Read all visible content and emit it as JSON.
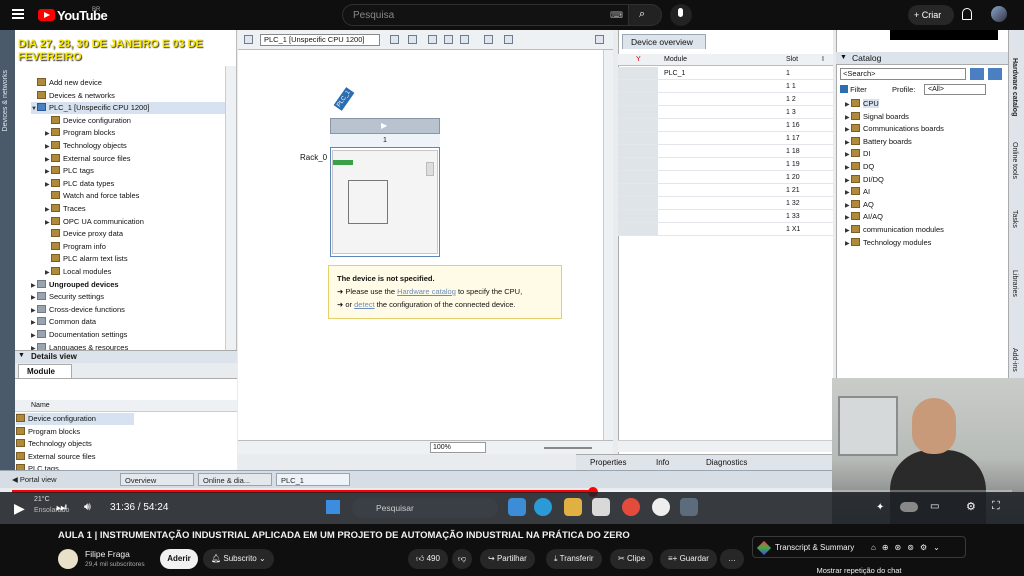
{
  "youtube": {
    "logo": "YouTube",
    "region": "BR",
    "search_placeholder": "Pesquisa",
    "create_label": "Criar"
  },
  "video": {
    "overlay_title": "DIA 27, 28, 30 DE JANEIRO E 03 DE FEVEREIRO",
    "time": "31:36 / 54:24",
    "progress_fraction": 0.581,
    "weather_temp": "21°C",
    "weather_desc": "Ensolarado",
    "taskbar_search": "Pesquisar"
  },
  "tia": {
    "tree": [
      {
        "label": "Add new device",
        "indent": 0
      },
      {
        "label": "Devices & networks",
        "indent": 0
      },
      {
        "label": "PLC_1 [Unspecific CPU 1200]",
        "indent": 0
      },
      {
        "label": "Device configuration",
        "indent": 1
      },
      {
        "label": "Program blocks",
        "indent": 1
      },
      {
        "label": "Technology objects",
        "indent": 1
      },
      {
        "label": "External source files",
        "indent": 1
      },
      {
        "label": "PLC tags",
        "indent": 1
      },
      {
        "label": "PLC data types",
        "indent": 1
      },
      {
        "label": "Watch and force tables",
        "indent": 1
      },
      {
        "label": "Traces",
        "indent": 1
      },
      {
        "label": "OPC UA communication",
        "indent": 1
      },
      {
        "label": "Device proxy data",
        "indent": 1
      },
      {
        "label": "Program info",
        "indent": 1
      },
      {
        "label": "PLC alarm text lists",
        "indent": 1
      },
      {
        "label": "Local modules",
        "indent": 1
      },
      {
        "label": "Ungrouped devices",
        "indent": 0
      },
      {
        "label": "Security settings",
        "indent": 0
      },
      {
        "label": "Cross-device functions",
        "indent": 0
      },
      {
        "label": "Common data",
        "indent": 0
      },
      {
        "label": "Documentation settings",
        "indent": 0
      },
      {
        "label": "Languages & resources",
        "indent": 0
      }
    ],
    "details_view": "Details view",
    "details_tab": "Module",
    "details_col_name": "Name",
    "details_rows": [
      "Device configuration",
      "Program blocks",
      "Technology objects",
      "External source files",
      "PLC tags"
    ],
    "device_select": "PLC_1 [Unspecific CPU 1200]",
    "plc_tag": "PLC_1",
    "rack_label": "Rack_0",
    "slot_number": "1",
    "info_title": "The device is not specified.",
    "info_line1_a": "Please use the",
    "info_line1_link": "Hardware catalog",
    "info_line1_b": "to specify the CPU,",
    "info_line2_a": "or",
    "info_line2_link": "detect",
    "info_line2_b": "the configuration of the connected device.",
    "zoom": "100%",
    "overview_tab": "Device overview",
    "overview_col_module": "Module",
    "overview_col_slot": "Slot",
    "overview_col_i": "I",
    "overview_rows": [
      {
        "module": "PLC_1",
        "slot": "1"
      },
      {
        "module": "",
        "slot": "1 1"
      },
      {
        "module": "",
        "slot": "1 2"
      },
      {
        "module": "",
        "slot": "1 3"
      },
      {
        "module": "",
        "slot": "1 16"
      },
      {
        "module": "",
        "slot": "1 17"
      },
      {
        "module": "",
        "slot": "1 18"
      },
      {
        "module": "",
        "slot": "1 19"
      },
      {
        "module": "",
        "slot": "1 20"
      },
      {
        "module": "",
        "slot": "1 21"
      },
      {
        "module": "",
        "slot": "1 32"
      },
      {
        "module": "",
        "slot": "1 33"
      },
      {
        "module": "",
        "slot": "1 X1"
      }
    ],
    "catalog_title": "Catalog",
    "catalog_search": "<Search>",
    "filter_label": "Filter",
    "profile_label": "Profile:",
    "profile_value": "<All>",
    "catalog_items": [
      "CPU",
      "Signal boards",
      "Communications boards",
      "Battery boards",
      "DI",
      "DQ",
      "DI/DQ",
      "AI",
      "AQ",
      "AI/AQ",
      "communication modules",
      "Technology modules"
    ],
    "rail_items": [
      "Hardware catalog",
      "Online tools",
      "Tasks",
      "Libraries",
      "Add-ins"
    ],
    "left_rail": "Devices & networks",
    "props_tabs": [
      "Properties",
      "Info",
      "Diagnostics"
    ],
    "portal_view": "Portal view",
    "portal_tabs": [
      "Overview",
      "Online & dia...",
      "PLC_1"
    ]
  },
  "below": {
    "title": "AULA 1 | INSTRUMENTAÇÃO INDUSTRIAL APLICADA EM UM PROJETO DE AUTOMAÇÃO INDUSTRIAL NA PRÁTICA DO ZERO",
    "channel": "Filipe Fraga",
    "subs": "29,4 mil subscritores",
    "join": "Aderir",
    "subscribe": "Subscrito",
    "likes": "490",
    "share": "Partilhar",
    "download": "Transferir",
    "clip": "Clipe",
    "save": "Guardar",
    "transcript": "Transcript & Summary",
    "chat_replay": "Mostrar repetição do chat"
  },
  "colors": {
    "youtube_red": "#ff0000",
    "overlay_yellow": "#f7e600",
    "tia_blue": "#2c6db0"
  }
}
